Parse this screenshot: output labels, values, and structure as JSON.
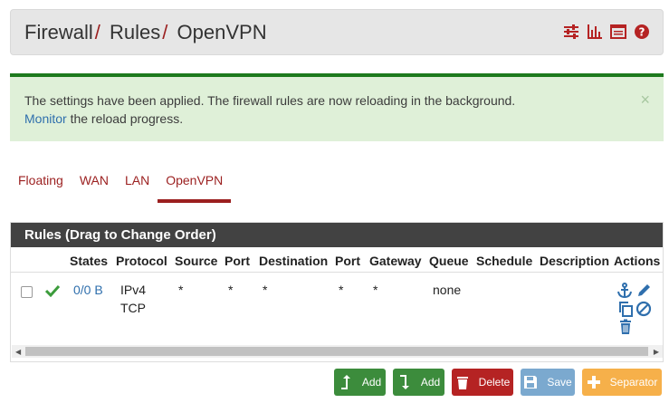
{
  "breadcrumb": [
    "Firewall",
    "Rules",
    "OpenVPN"
  ],
  "header_icons": [
    "sliders-icon",
    "bar-chart-icon",
    "list-icon",
    "help-icon"
  ],
  "alert": {
    "message": "The settings have been applied. The firewall rules are now reloading in the background.",
    "link_text": "Monitor",
    "link_suffix": " the reload progress.",
    "close": "×"
  },
  "tabs": [
    "Floating",
    "WAN",
    "LAN",
    "OpenVPN"
  ],
  "active_tab": "OpenVPN",
  "panel": {
    "title": "Rules (Drag to Change Order)",
    "columns": [
      "States",
      "Protocol",
      "Source",
      "Port",
      "Destination",
      "Port",
      "Gateway",
      "Queue",
      "Schedule",
      "Description",
      "Actions"
    ],
    "rows": [
      {
        "states": "0/0 B",
        "protocol_line1": "IPv4",
        "protocol_line2": "TCP",
        "source": "*",
        "source_port": "*",
        "destination": "*",
        "destination_port": "*",
        "gateway": "*",
        "queue": "none",
        "schedule": "",
        "description": ""
      }
    ]
  },
  "buttons": {
    "add_top": "Add",
    "add_bottom": "Add",
    "delete": "Delete",
    "save": "Save",
    "separator": "Separator"
  },
  "colors": {
    "brand_red": "#9b1f1f",
    "add_green": "#3c8c3c",
    "delete_red": "#b52323",
    "save_blue": "#7ba9cf",
    "separator_orange": "#f6b04a",
    "alert_bg": "#dff0d8"
  }
}
